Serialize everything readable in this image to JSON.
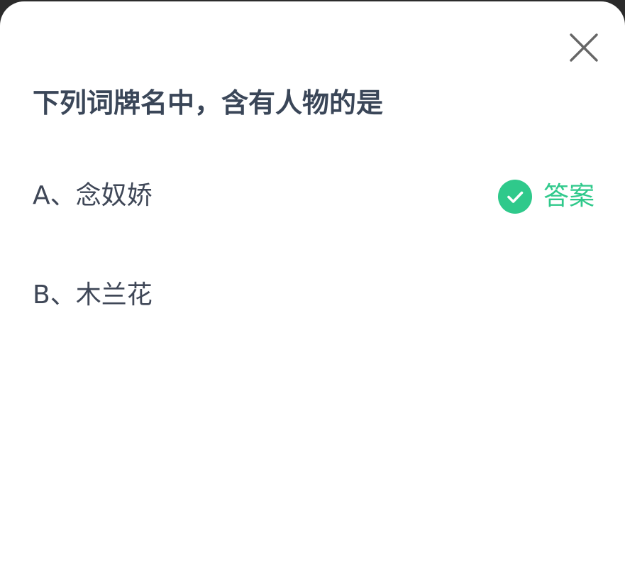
{
  "question": {
    "text": "下列词牌名中，含有人物的是"
  },
  "options": [
    {
      "text": "A、念奴娇",
      "is_answer": true
    },
    {
      "text": "B、木兰花",
      "is_answer": false
    }
  ],
  "answer_badge": {
    "label": "答案",
    "icon": "check-circle-icon"
  },
  "close": {
    "icon": "close-icon"
  },
  "colors": {
    "accent": "#2fc98b",
    "question_text": "#3a4658",
    "option_text": "#3f4757",
    "close_icon": "#666666"
  }
}
